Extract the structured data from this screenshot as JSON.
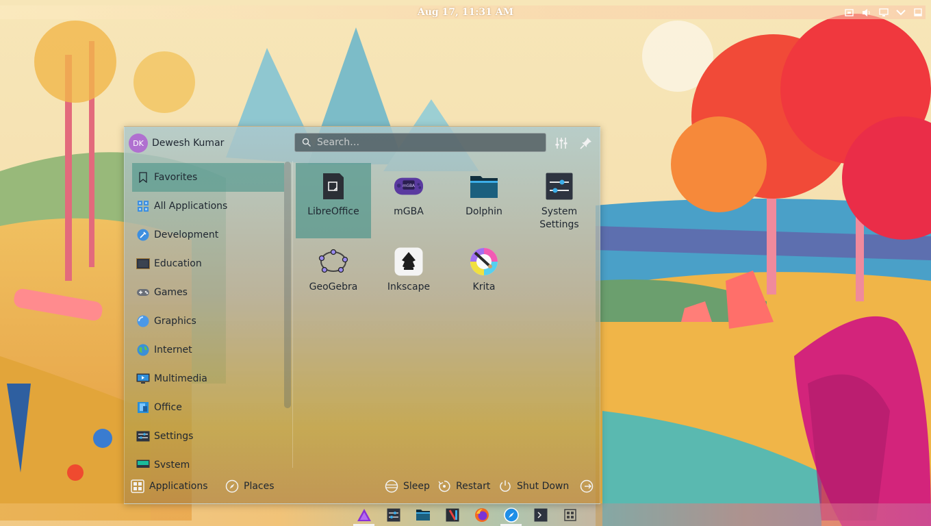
{
  "top_panel": {
    "clock": "Aug 17, 11:31 AM",
    "tray_icons": [
      "screen-icon",
      "volume-icon",
      "network-icon",
      "chevron-down-icon",
      "show-desktop-icon"
    ]
  },
  "launcher": {
    "user": {
      "initials": "DK",
      "name": "Dewesh Kumar"
    },
    "search": {
      "placeholder": "Search…",
      "value": ""
    },
    "categories": [
      {
        "label": "Favorites",
        "icon": "bookmark-icon",
        "selected": true
      },
      {
        "label": "All Applications",
        "icon": "grid-icon"
      },
      {
        "label": "Development",
        "icon": "development-icon"
      },
      {
        "label": "Education",
        "icon": "education-icon"
      },
      {
        "label": "Games",
        "icon": "gamepad-icon"
      },
      {
        "label": "Graphics",
        "icon": "graphics-icon"
      },
      {
        "label": "Internet",
        "icon": "globe-icon"
      },
      {
        "label": "Multimedia",
        "icon": "multimedia-icon"
      },
      {
        "label": "Office",
        "icon": "office-icon"
      },
      {
        "label": "Settings",
        "icon": "settings-icon"
      },
      {
        "label": "System",
        "icon": "system-icon"
      }
    ],
    "apps": [
      {
        "label": "LibreOffice",
        "icon": "libreoffice-icon",
        "selected": true
      },
      {
        "label": "mGBA",
        "icon": "mgba-icon"
      },
      {
        "label": "Dolphin",
        "icon": "dolphin-icon"
      },
      {
        "label": "System Settings",
        "icon": "system-settings-icon"
      },
      {
        "label": "GeoGebra",
        "icon": "geogebra-icon"
      },
      {
        "label": "Inkscape",
        "icon": "inkscape-icon"
      },
      {
        "label": "Krita",
        "icon": "krita-icon"
      }
    ],
    "footer": {
      "applications": "Applications",
      "places": "Places",
      "sleep": "Sleep",
      "restart": "Restart",
      "shutdown": "Shut Down"
    }
  },
  "taskbar": {
    "items": [
      "launcher-icon",
      "system-settings-icon",
      "dolphin-icon",
      "kate-icon",
      "firefox-icon",
      "safari-icon",
      "terminal-icon",
      "overview-icon"
    ]
  },
  "colors": {
    "selection": "#50968c",
    "avatar": "#b070d0"
  }
}
